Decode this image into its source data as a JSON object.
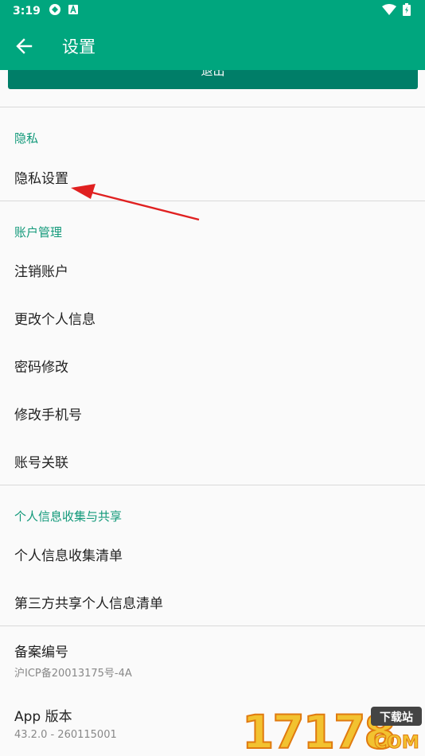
{
  "status_bar": {
    "time": "3:19"
  },
  "app_bar": {
    "title": "设置"
  },
  "top_button": {
    "label": "退出"
  },
  "sections": {
    "privacy": {
      "header": "隐私",
      "items": [
        "隐私设置"
      ]
    },
    "account": {
      "header": "账户管理",
      "items": [
        "注销账户",
        "更改个人信息",
        "密码修改",
        "修改手机号",
        "账号关联"
      ]
    },
    "info": {
      "header": "个人信息收集与共享",
      "items": [
        "个人信息收集清单",
        "第三方共享个人信息清单"
      ]
    }
  },
  "filing": {
    "title": "备案编号",
    "value": "沪ICP备20013175号-4A"
  },
  "version": {
    "title": "App 版本",
    "value": "43.2.0 - 260115001"
  },
  "watermark": {
    "number": "17178",
    "badge": "下载站",
    "domain": "COM"
  },
  "colors": {
    "primary": "#00a67e",
    "accent": "#12997a",
    "arrow": "#e02020"
  }
}
